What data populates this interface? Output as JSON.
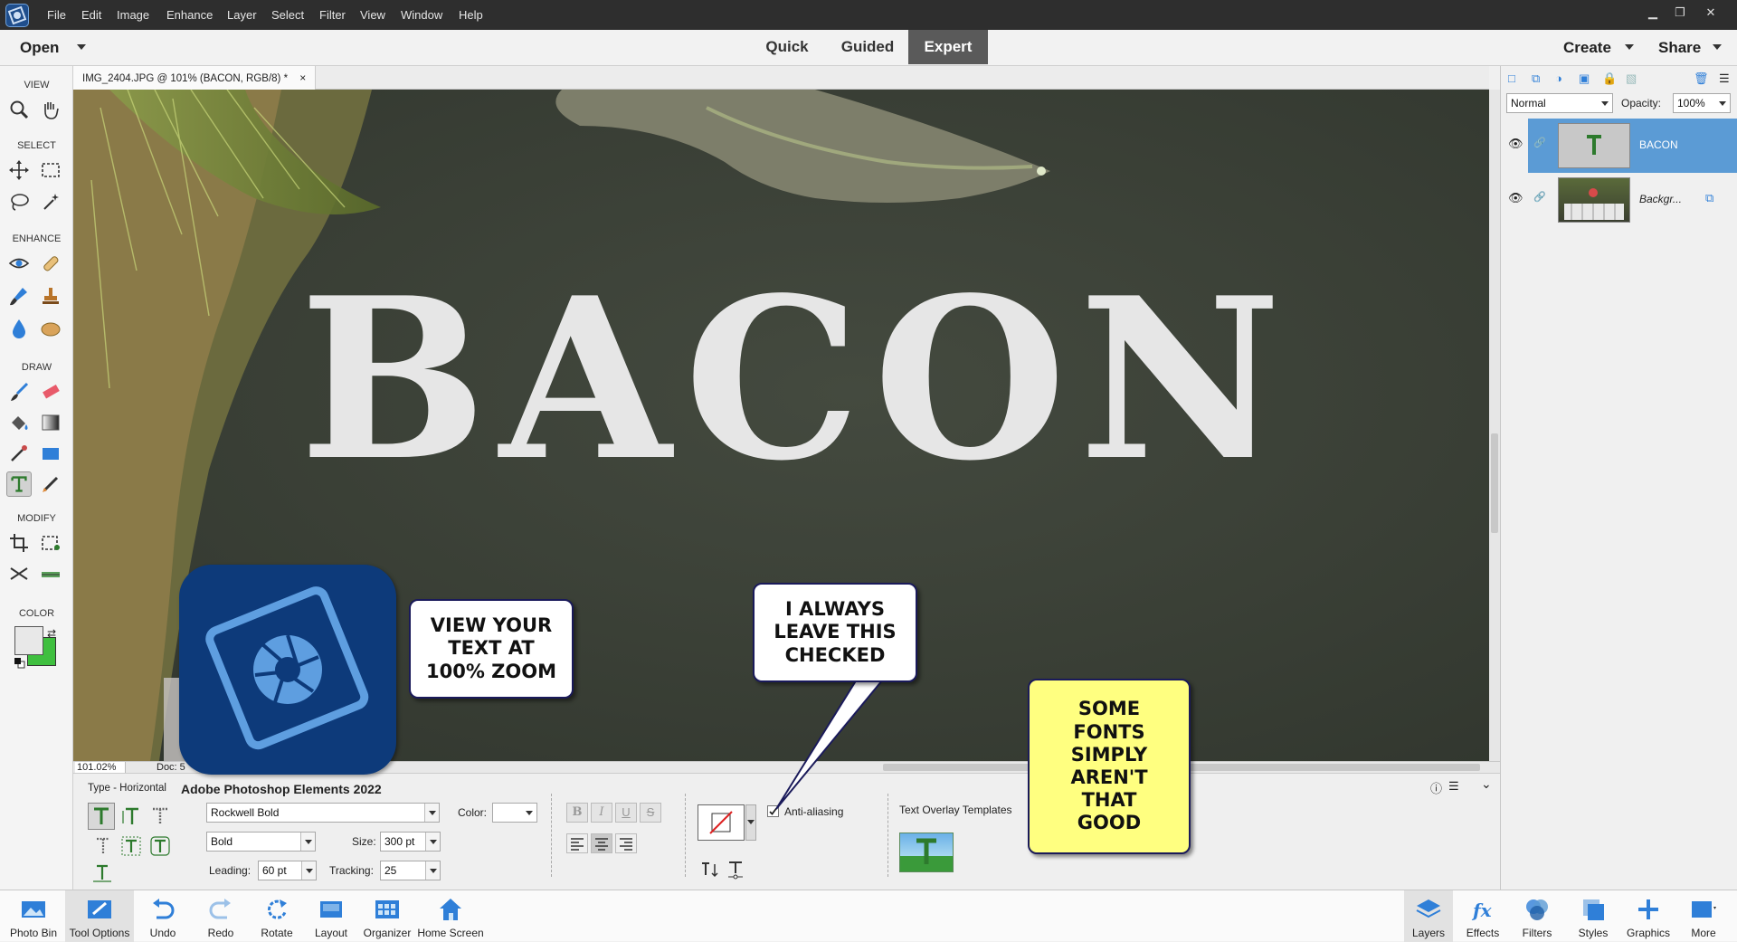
{
  "menubar": {
    "items": [
      "File",
      "Edit",
      "Image",
      "Enhance",
      "Layer",
      "Select",
      "Filter",
      "View",
      "Window",
      "Help"
    ]
  },
  "modebar": {
    "open_label": "Open",
    "modes": [
      "Quick",
      "Guided",
      "Expert"
    ],
    "active_mode": "Expert",
    "create_label": "Create",
    "share_label": "Share"
  },
  "toolbox": {
    "sections": [
      "VIEW",
      "SELECT",
      "ENHANCE",
      "DRAW",
      "MODIFY",
      "COLOR"
    ],
    "foreground_color": "#e8e8e8",
    "background_color": "#3fbf3f"
  },
  "document": {
    "tab_title": "IMG_2404.JPG @ 101% (BACON, RGB/8) *",
    "canvas_text": "BACON",
    "zoom_readout": "101.02%",
    "doc_readout": "Doc: 5"
  },
  "options": {
    "tool_name": "Type - Horizontal",
    "app_name": "Adobe Photoshop Elements 2022",
    "font_family": "Rockwell Bold",
    "font_style": "Bold",
    "color_label": "Color:",
    "size_label": "Size:",
    "size_value": "300 pt",
    "leading_label": "Leading:",
    "leading_value": "60 pt",
    "tracking_label": "Tracking:",
    "tracking_value": "25",
    "antialias_label": "Anti-aliasing",
    "antialias_checked": true,
    "text_overlay_label": "Text Overlay Templates"
  },
  "layers_panel": {
    "blend_mode": "Normal",
    "opacity_label": "Opacity:",
    "opacity_value": "100%",
    "layers": [
      {
        "name": "BACON",
        "selected": true
      },
      {
        "name": "Backgr...",
        "selected": false
      }
    ]
  },
  "callouts": {
    "zoom_note": "VIEW YOUR\nTEXT AT\n100% ZOOM",
    "antialias_note": "I ALWAYS\nLEAVE THIS\nCHECKED",
    "fonts_note": "SOME\nFONTS\nSIMPLY\nAREN'T\nTHAT\nGOOD"
  },
  "bottombar": {
    "left": [
      "Photo Bin",
      "Tool Options",
      "Undo",
      "Redo",
      "Rotate",
      "Layout",
      "Organizer",
      "Home Screen"
    ],
    "right": [
      "Layers",
      "Effects",
      "Filters",
      "Styles",
      "Graphics",
      "More"
    ]
  },
  "colors": {
    "accent": "#5b9bd5",
    "callout_yellow": "#ffff80",
    "logo_blue": "#0d3a7a"
  }
}
